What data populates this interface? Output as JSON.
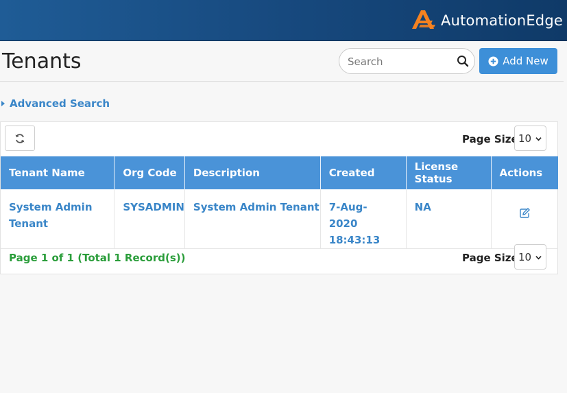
{
  "brand": {
    "name": "AutomationEdge",
    "logo_color": "#f58220"
  },
  "page": {
    "title": "Tenants"
  },
  "search": {
    "placeholder": "Search"
  },
  "toolbar": {
    "add_new_label": "Add New"
  },
  "advanced_search": {
    "label": "Advanced Search"
  },
  "table": {
    "page_size_label": "Page Size",
    "page_size_value": "10",
    "columns": [
      "Tenant Name",
      "Org Code",
      "Description",
      "Created",
      "License Status",
      "Actions"
    ],
    "rows": [
      {
        "tenant_name": "System Admin Tenant",
        "org_code": "SYSADMIN",
        "description": "System Admin Tenant",
        "created": "7-Aug-2020 18:43:13",
        "license_status": "NA",
        "action_icon": "edit-icon"
      }
    ],
    "footer_text": "Page 1 of 1 (Total 1 Record(s))"
  },
  "colors": {
    "header_blue": "#4a93d8",
    "link_blue": "#3a86c8",
    "success_green": "#2a9d3a",
    "topbar": "#17497e"
  }
}
